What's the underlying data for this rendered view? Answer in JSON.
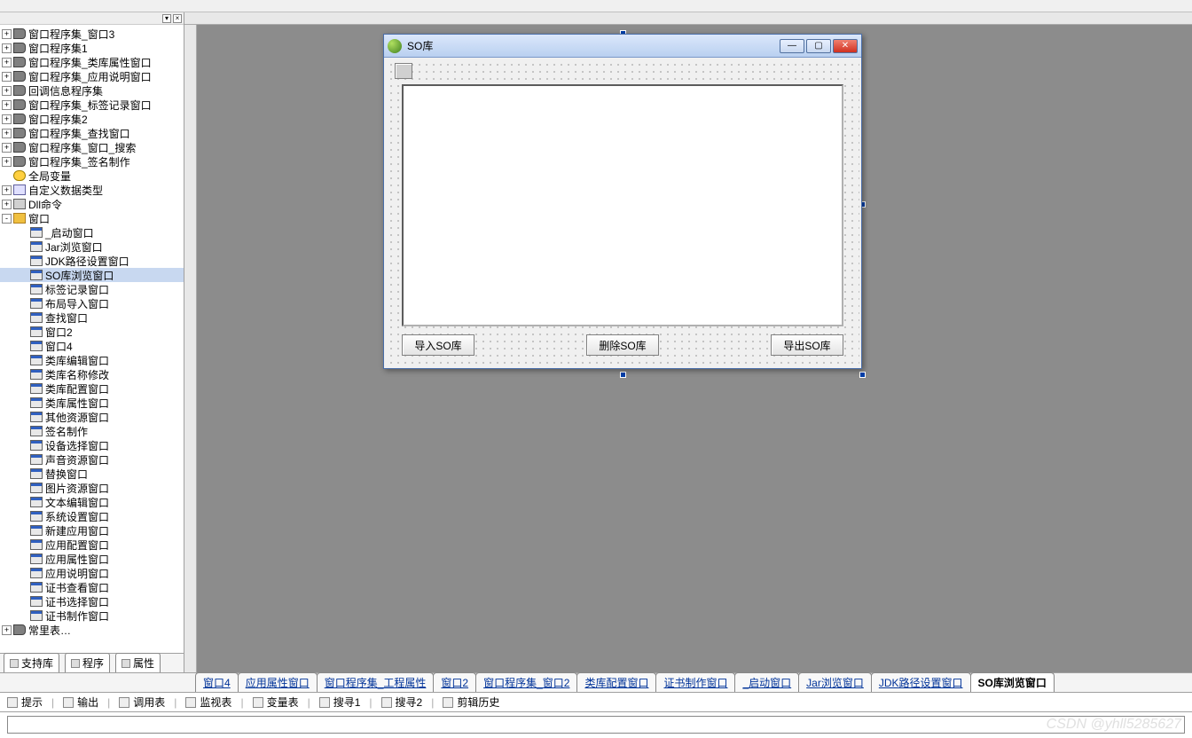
{
  "tree": {
    "top": [
      {
        "label": "窗口程序集_窗口3",
        "exp": "+",
        "ico": "module"
      },
      {
        "label": "窗口程序集1",
        "exp": "+",
        "ico": "module"
      },
      {
        "label": "窗口程序集_类库属性窗口",
        "exp": "+",
        "ico": "module"
      },
      {
        "label": "窗口程序集_应用说明窗口",
        "exp": "+",
        "ico": "module"
      },
      {
        "label": "回调信息程序集",
        "exp": "+",
        "ico": "module"
      },
      {
        "label": "窗口程序集_标签记录窗口",
        "exp": "+",
        "ico": "module"
      },
      {
        "label": "窗口程序集2",
        "exp": "+",
        "ico": "module"
      },
      {
        "label": "窗口程序集_查找窗口",
        "exp": "+",
        "ico": "module"
      },
      {
        "label": "窗口程序集_窗口_搜索",
        "exp": "+",
        "ico": "module"
      },
      {
        "label": "窗口程序集_签名制作",
        "exp": "+",
        "ico": "module"
      },
      {
        "label": "全局变量",
        "exp": "",
        "ico": "global"
      },
      {
        "label": "自定义数据类型",
        "exp": "+",
        "ico": "type"
      },
      {
        "label": "Dll命令",
        "exp": "+",
        "ico": "dll"
      },
      {
        "label": "窗口",
        "exp": "-",
        "ico": "folder"
      }
    ],
    "windows": [
      {
        "label": "_启动窗口"
      },
      {
        "label": "Jar浏览窗口"
      },
      {
        "label": "JDK路径设置窗口"
      },
      {
        "label": "SO库浏览窗口",
        "selected": true
      },
      {
        "label": "标签记录窗口"
      },
      {
        "label": "布局导入窗口"
      },
      {
        "label": "查找窗口"
      },
      {
        "label": "窗口2"
      },
      {
        "label": "窗口4"
      },
      {
        "label": "类库编辑窗口"
      },
      {
        "label": "类库名称修改"
      },
      {
        "label": "类库配置窗口"
      },
      {
        "label": "类库属性窗口"
      },
      {
        "label": "其他资源窗口"
      },
      {
        "label": "签名制作"
      },
      {
        "label": "设备选择窗口"
      },
      {
        "label": "声音资源窗口"
      },
      {
        "label": "替换窗口"
      },
      {
        "label": "图片资源窗口"
      },
      {
        "label": "文本编辑窗口"
      },
      {
        "label": "系统设置窗口"
      },
      {
        "label": "新建应用窗口"
      },
      {
        "label": "应用配置窗口"
      },
      {
        "label": "应用属性窗口"
      },
      {
        "label": "应用说明窗口"
      },
      {
        "label": "证书查看窗口"
      },
      {
        "label": "证书选择窗口"
      },
      {
        "label": "证书制作窗口"
      }
    ],
    "bottom_extra": {
      "label": "常里表…",
      "ico": "module"
    }
  },
  "left_tabs": [
    {
      "label": "支持库"
    },
    {
      "label": "程序"
    },
    {
      "label": "属性"
    }
  ],
  "form": {
    "title": "SO库",
    "buttons": {
      "import": "导入SO库",
      "delete": "删除SO库",
      "export": "导出SO库"
    }
  },
  "doc_tabs": [
    {
      "label": "窗口4"
    },
    {
      "label": "应用属性窗口"
    },
    {
      "label": "窗口程序集_工程属性"
    },
    {
      "label": "窗口2"
    },
    {
      "label": "窗口程序集_窗口2"
    },
    {
      "label": "类库配置窗口"
    },
    {
      "label": "证书制作窗口"
    },
    {
      "label": "_启动窗口"
    },
    {
      "label": "Jar浏览窗口"
    },
    {
      "label": "JDK路径设置窗口"
    },
    {
      "label": "SO库浏览窗口",
      "active": true
    }
  ],
  "output_tabs": [
    {
      "label": "提示"
    },
    {
      "label": "输出"
    },
    {
      "label": "调用表"
    },
    {
      "label": "监视表"
    },
    {
      "label": "变量表"
    },
    {
      "label": "搜寻1"
    },
    {
      "label": "搜寻2"
    },
    {
      "label": "剪辑历史"
    }
  ],
  "watermark": "CSDN @yhll5285627"
}
